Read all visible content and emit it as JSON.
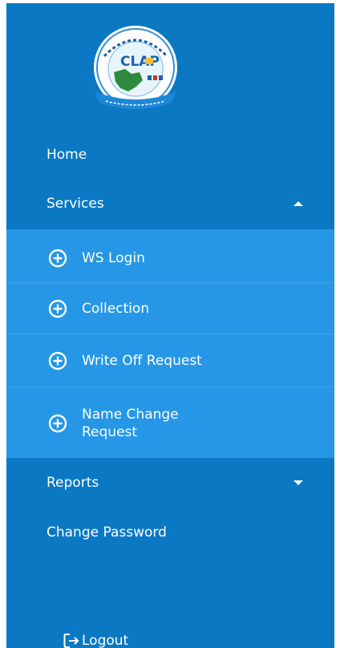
{
  "logo": {
    "brand_text": "CLAP",
    "ring_text": "జగనన్న స్వచ్ఛ సంకల్పం",
    "banner_text": "Clean Andhra Pradesh",
    "colors": {
      "ring": "#2f8fd6",
      "brand": "#1b5fae",
      "map": "#2e8b3d",
      "banner": "#1e88d8"
    }
  },
  "nav": {
    "home": "Home",
    "services": "Services",
    "reports": "Reports",
    "change_password": "Change Password",
    "logout": "Logout"
  },
  "services": {
    "expanded": true,
    "items": [
      {
        "label": "WS Login"
      },
      {
        "label": "Collection"
      },
      {
        "label": "Write Off Request"
      },
      {
        "label": "Name Change Request",
        "label_line1": "Name Change",
        "label_line2": "Request"
      }
    ]
  },
  "theme": {
    "sidebar_bg": "#0b78c4",
    "submenu_bg": "#2597e6",
    "text": "#ffffff"
  }
}
